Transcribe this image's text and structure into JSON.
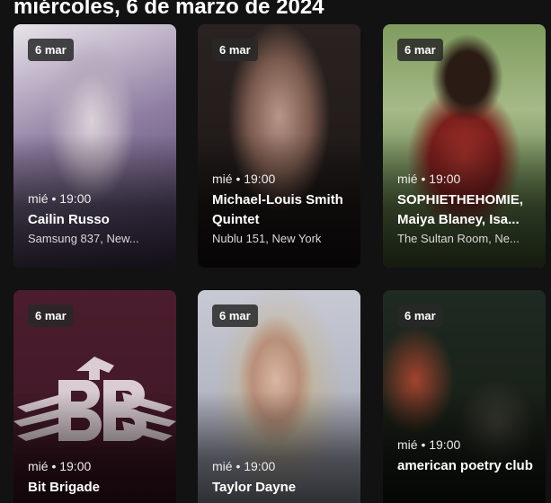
{
  "section": {
    "title": "miércoles, 6 de marzo de 2024"
  },
  "events": [
    {
      "date": "6 mar",
      "time": "mié • 19:00",
      "name": "Cailin Russo",
      "venue": "Samsung 837, New..."
    },
    {
      "date": "6 mar",
      "time": "mié • 19:00",
      "name": "Michael-Louis Smith Quintet",
      "venue": "Nublu 151, New York"
    },
    {
      "date": "6 mar",
      "time": "mié • 19:00",
      "name": "SOPHIETHEHOMIE, Maiya Blaney, Isa...",
      "venue": "The Sultan Room, Ne..."
    },
    {
      "date": "6 mar",
      "time": "mié • 19:00",
      "name": "Bit Brigade",
      "venue": ""
    },
    {
      "date": "6 mar",
      "time": "mié • 19:00",
      "name": "Taylor Dayne",
      "venue": ""
    },
    {
      "date": "6 mar",
      "time": "mié • 19:00",
      "name": "american poetry club",
      "venue": ""
    }
  ]
}
